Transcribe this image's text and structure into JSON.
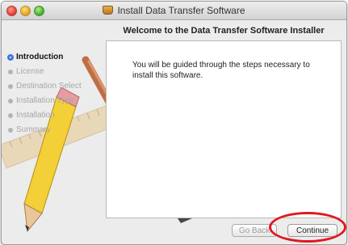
{
  "window": {
    "title": "Install Data Transfer Software"
  },
  "header": {
    "title": "Welcome to the Data Transfer Software Installer"
  },
  "sidebar": {
    "steps": [
      {
        "label": "Introduction",
        "active": true
      },
      {
        "label": "License",
        "active": false
      },
      {
        "label": "Destination Select",
        "active": false
      },
      {
        "label": "Installation Type",
        "active": false
      },
      {
        "label": "Installation",
        "active": false
      },
      {
        "label": "Summary",
        "active": false
      }
    ]
  },
  "main": {
    "body_text": "You will be guided through the steps necessary to install this software."
  },
  "footer": {
    "go_back_label": "Go Back",
    "continue_label": "Continue"
  },
  "colors": {
    "active_step": "#3f78d8",
    "highlight_ring": "#e0171f"
  }
}
